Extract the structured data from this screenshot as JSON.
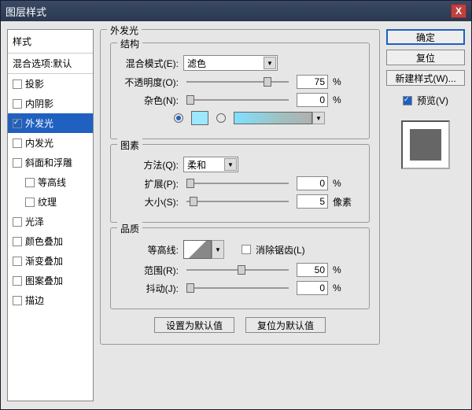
{
  "window": {
    "title": "图层样式",
    "close": "X"
  },
  "sidebar": {
    "header": "样式",
    "blend_options": "混合选项:默认",
    "items": [
      {
        "label": "投影",
        "checked": false,
        "selected": false,
        "indent": false
      },
      {
        "label": "内阴影",
        "checked": false,
        "selected": false,
        "indent": false
      },
      {
        "label": "外发光",
        "checked": true,
        "selected": true,
        "indent": false
      },
      {
        "label": "内发光",
        "checked": false,
        "selected": false,
        "indent": false
      },
      {
        "label": "斜面和浮雕",
        "checked": false,
        "selected": false,
        "indent": false
      },
      {
        "label": "等高线",
        "checked": false,
        "selected": false,
        "indent": true
      },
      {
        "label": "纹理",
        "checked": false,
        "selected": false,
        "indent": true
      },
      {
        "label": "光泽",
        "checked": false,
        "selected": false,
        "indent": false
      },
      {
        "label": "颜色叠加",
        "checked": false,
        "selected": false,
        "indent": false
      },
      {
        "label": "渐变叠加",
        "checked": false,
        "selected": false,
        "indent": false
      },
      {
        "label": "图案叠加",
        "checked": false,
        "selected": false,
        "indent": false
      },
      {
        "label": "描边",
        "checked": false,
        "selected": false,
        "indent": false
      }
    ]
  },
  "panel": {
    "title": "外发光",
    "structure": {
      "title": "结构",
      "blend_mode_label": "混合模式(E):",
      "blend_mode_value": "滤色",
      "opacity_label": "不透明度(O):",
      "opacity_value": "75",
      "opacity_unit": "%",
      "noise_label": "杂色(N):",
      "noise_value": "0",
      "noise_unit": "%",
      "color_hex": "#9be8ff",
      "gradient_css": "linear-gradient(90deg,#80e0ff,#a0c0c0 60%,#b0b0b0)"
    },
    "elements": {
      "title": "图素",
      "technique_label": "方法(Q):",
      "technique_value": "柔和",
      "spread_label": "扩展(P):",
      "spread_value": "0",
      "spread_unit": "%",
      "size_label": "大小(S):",
      "size_value": "5",
      "size_unit": "像素"
    },
    "quality": {
      "title": "品质",
      "contour_label": "等高线:",
      "antialias_label": "消除锯齿(L)",
      "range_label": "范围(R):",
      "range_value": "50",
      "range_unit": "%",
      "jitter_label": "抖动(J):",
      "jitter_value": "0",
      "jitter_unit": "%"
    },
    "buttons": {
      "set_default": "设置为默认值",
      "reset_default": "复位为默认值"
    }
  },
  "right": {
    "ok": "确定",
    "cancel": "复位",
    "new_style": "新建样式(W)...",
    "preview_label": "预览(V)"
  }
}
